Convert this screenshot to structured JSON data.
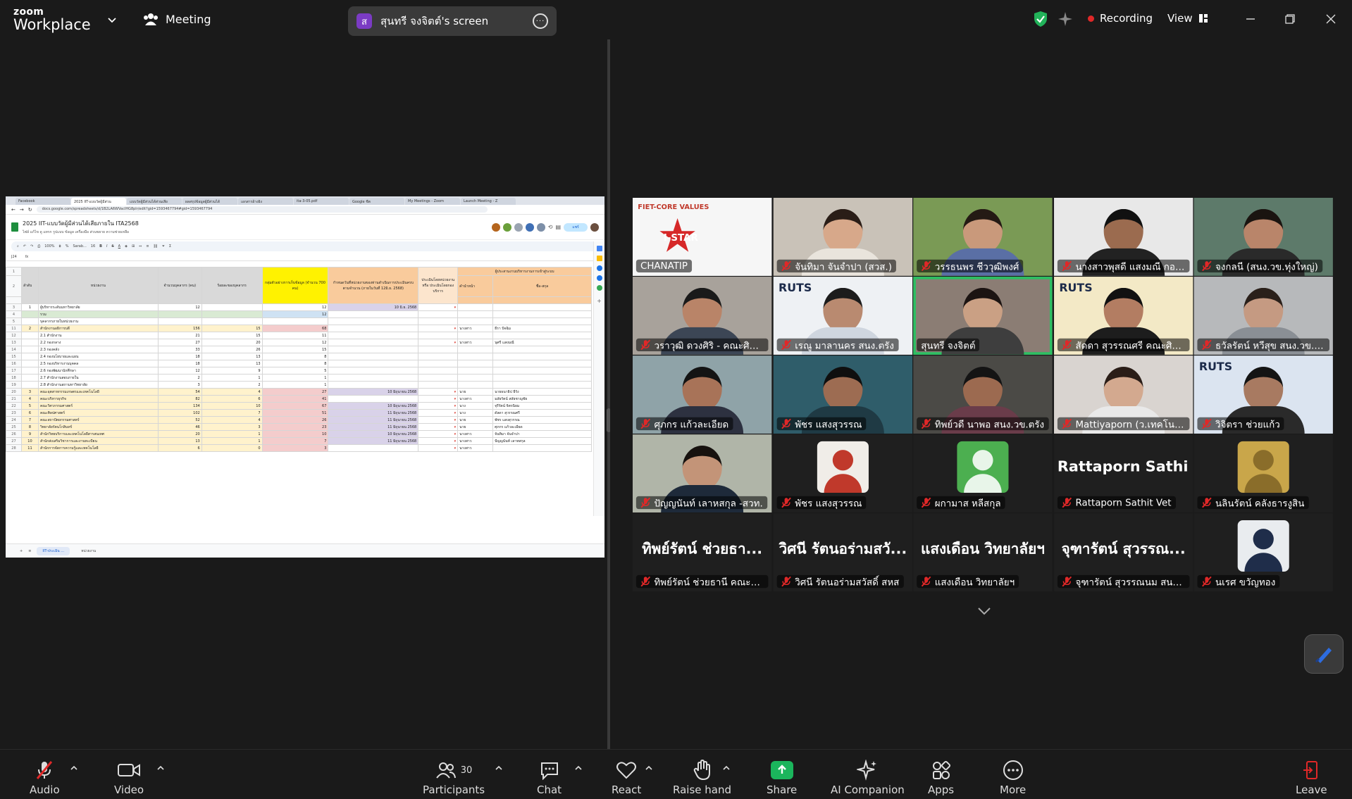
{
  "app": {
    "logo_line1": "zoom",
    "logo_line2": "Workplace",
    "meeting_label": "Meeting",
    "share_avatar_letter": "ส",
    "share_title": "สุนทรี จงจิตต์'s screen",
    "recording_label": "Recording",
    "view_label": "View",
    "accent_green": "#2dbf62",
    "recording_red": "#e02828"
  },
  "shared_screen": {
    "browser_tabs": [
      "Facebook",
      "2025 IIT-แบบวัดผู้มีส่วน",
      "แบบวัดผู้มีส่วนได้ส่วนเสีย",
      "ผลสรุปข้อมูลผู้มีส่วนได้",
      "เอกสารอ้างอิง",
      "ita-3-05.pdf",
      "Google ชีต",
      "My Meetings - Zoom",
      "Launch Meeting - Z"
    ],
    "url": "docs.google.com/spreadsheets/d/1B2LA6WVacIHG8plr/edit?gid=1593467794#gid=1593467794",
    "doc_title": "2025 IIT-แบบวัดผู้มีส่วนได้เสียภายใน ITA2568",
    "doc_menu": "ไฟล์  แก้ไข  ดู  แทรก  รูปแบบ  ข้อมูล  เครื่องมือ  ส่วนขยาย  ความช่วยเหลือ",
    "share_btn": "แชร์",
    "toolbar_zoom": "100%",
    "toolbar_font": "Sarab...",
    "toolbar_size": "16",
    "cell_ref": "J24",
    "headers": {
      "col_no": "ลำดับ",
      "col_unit": "หน่วยงาน",
      "col_staff": "จำนวนบุคลากร (คน)",
      "col_pct": "ร้อยละของบุคลากร",
      "col_target": "กลุ่มตัวอย่างการเก็บข้อมูล (จำนวน 700 คน)",
      "col_deadline": "กำหนดวันที่หน่วยงานของท่านดำเนินการประเมินครบตามจำนวน (ภายในวันที่ 12มิ.ย. 2568)",
      "col_eval": "ประเมินโดยหน่วยงาน หรือ ประเมินโดยกองบริการ",
      "col_contact": "ผู้ประสานงานบริหารงานการเข้าสู่ระบบ",
      "col_prefix": "คำนำหน้า",
      "col_name": "ชื่อ-สกุล"
    },
    "rows": [
      {
        "rn": "3",
        "no": "1",
        "unit": "ผู้บริหารระดับมหาวิทยาลัย",
        "staff": "12",
        "pct": "",
        "target": "12",
        "date": "10 มิ.ย. 2568",
        "prefix": "",
        "name": "",
        "tone": "plain"
      },
      {
        "rn": "4",
        "no": "",
        "unit": "รวม",
        "staff": "",
        "pct": "",
        "target": "12",
        "date": "",
        "prefix": "",
        "name": "",
        "tone": "green"
      },
      {
        "rn": "5",
        "no": "",
        "unit": "บุคลากรภายในหน่วยงาน",
        "staff": "",
        "pct": "",
        "target": "",
        "date": "",
        "prefix": "",
        "name": "",
        "tone": "plain"
      },
      {
        "rn": "11",
        "no": "2",
        "unit": "สำนักงานอธิการบดี",
        "staff": "156",
        "pct": "15",
        "target": "68",
        "date": "",
        "prefix": "นางสาว",
        "name": "ธีรา ปัจฉิม",
        "tone": "yellow"
      },
      {
        "rn": "12",
        "no": "",
        "unit": "2.1 สำนักงาน",
        "staff": "21",
        "pct": "15",
        "target": "11",
        "date": "",
        "prefix": "",
        "name": "",
        "tone": "plain"
      },
      {
        "rn": "13",
        "no": "",
        "unit": "2.2 กองกลาง",
        "staff": "27",
        "pct": "20",
        "target": "12",
        "date": "",
        "prefix": "นางสาว",
        "name": "นุศรี แสงมณี",
        "tone": "plain"
      },
      {
        "rn": "14",
        "no": "",
        "unit": "2.3 กองคลัง",
        "staff": "33",
        "pct": "26",
        "target": "15",
        "date": "",
        "prefix": "",
        "name": "",
        "tone": "plain"
      },
      {
        "rn": "15",
        "no": "",
        "unit": "2.4 กองนโยบายและแผน",
        "staff": "18",
        "pct": "13",
        "target": "8",
        "date": "",
        "prefix": "",
        "name": "",
        "tone": "plain"
      },
      {
        "rn": "16",
        "no": "",
        "unit": "2.5 กองบริหารงานบุคคล",
        "staff": "18",
        "pct": "13",
        "target": "8",
        "date": "",
        "prefix": "",
        "name": "",
        "tone": "plain"
      },
      {
        "rn": "17",
        "no": "",
        "unit": "2.6 กองพัฒนานักศึกษา",
        "staff": "12",
        "pct": "9",
        "target": "5",
        "date": "",
        "prefix": "",
        "name": "",
        "tone": "plain"
      },
      {
        "rn": "18",
        "no": "",
        "unit": "2.7 สำนักงานสอบภายใน",
        "staff": "2",
        "pct": "1",
        "target": "1",
        "date": "",
        "prefix": "",
        "name": "",
        "tone": "plain"
      },
      {
        "rn": "19",
        "no": "",
        "unit": "2.8 สำนักงานสภามหาวิทยาลัย",
        "staff": "3",
        "pct": "2",
        "target": "1",
        "date": "",
        "prefix": "",
        "name": "",
        "tone": "plain"
      },
      {
        "rn": "20",
        "no": "3",
        "unit": "คณะอุตสาหกรรมเกษตรและเทคโนโลยี",
        "staff": "54",
        "pct": "4",
        "target": "27",
        "date": "10 มิถุนายน 2568",
        "prefix": "นาย",
        "name": "นายธนาธิป ธีรัง",
        "tone": "yellow"
      },
      {
        "rn": "21",
        "no": "4",
        "unit": "คณะบริหารธุรกิจ",
        "staff": "82",
        "pct": "6",
        "target": "41",
        "date": "",
        "prefix": "นางสาว",
        "name": "มลัยรัตน์ สลัยชาญชัย",
        "tone": "yellow"
      },
      {
        "rn": "22",
        "no": "5",
        "unit": "คณะวิศวกรรมศาสตร์",
        "staff": "134",
        "pct": "10",
        "target": "67",
        "date": "10 มิถุนายน 2568",
        "prefix": "นาง",
        "name": "จุรีรัตน์ จิตรนิยม",
        "tone": "yellow"
      },
      {
        "rn": "23",
        "no": "6",
        "unit": "คณะศิลปศาสตร์",
        "staff": "102",
        "pct": "7",
        "target": "51",
        "date": "11 มิถุนายน 2568",
        "prefix": "นาง",
        "name": "ดัลดา สุวรรณศรี",
        "tone": "yellow"
      },
      {
        "rn": "24",
        "no": "7",
        "unit": "คณะสถาปัตยกรรมศาสตร์",
        "staff": "52",
        "pct": "4",
        "target": "26",
        "date": "11 มิถุนายน 2568",
        "prefix": "นาย",
        "name": "พัชร แสงสุวรรณ",
        "tone": "yellow"
      },
      {
        "rn": "25",
        "no": "8",
        "unit": "วิทยาลัยรัตนโกสินทร์",
        "staff": "46",
        "pct": "3",
        "target": "23",
        "date": "11 มิถุนายน 2568",
        "prefix": "นาย",
        "name": "ศุภกร แก้วละเอียด",
        "tone": "yellow"
      },
      {
        "rn": "26",
        "no": "9",
        "unit": "สำนักวิทยบริการและเทคโนโลยีสารสนเทศ",
        "staff": "20",
        "pct": "1",
        "target": "10",
        "date": "10 มิถุนายน 2568",
        "prefix": "นางสาว",
        "name": "จันทิมา จันจำปา",
        "tone": "yellow"
      },
      {
        "rn": "27",
        "no": "10",
        "unit": "สำนักส่งเสริมวิชาการและงานทะเบียน",
        "staff": "13",
        "pct": "1",
        "target": "7",
        "date": "11 มิถุนายน 2568",
        "prefix": "นางสาว",
        "name": "ปัญญนันท์ เลาหสกุล",
        "tone": "yellow"
      },
      {
        "rn": "28",
        "no": "11",
        "unit": "สำนักการจัดการความรู้และเทคโนโลยี",
        "staff": "6",
        "pct": "0",
        "target": "3",
        "date": "",
        "prefix": "นางสาว",
        "name": "",
        "tone": "yellow"
      }
    ],
    "sheet_tabs": [
      "IIT-ประเมิน ...",
      "หน่วยงาน"
    ]
  },
  "gallery": {
    "tiles": [
      {
        "name": "CHANATIP",
        "kind": "slide",
        "muted": false,
        "bg": "#f2f2f2",
        "slide_title": "FIET-CORE VALUES",
        "slide_big": "I-STAR"
      },
      {
        "name": "จันทิมา จันจำปา (สวส.)",
        "kind": "person",
        "muted": true,
        "bg": "#c9c2b8",
        "skin": "#d7a88a",
        "shirt": "#e9e4dc",
        "hair": "#2a1d17"
      },
      {
        "name": "วรรธนพร ชีววุฒิพงศ์",
        "kind": "person",
        "muted": true,
        "bg": "#7a9a55",
        "skin": "#c9997b",
        "shirt": "#5a6fa5",
        "hair": "#241a14"
      },
      {
        "name": "นางสาวพุสดี แสงมณี กอง...",
        "kind": "person",
        "muted": true,
        "bg": "#e8e8e8",
        "skin": "#9b6b4f",
        "shirt": "#222222",
        "hair": "#111111"
      },
      {
        "name": "จงกลนี (สนง.วข.ทุ่งใหญ่)",
        "kind": "person",
        "muted": true,
        "bg": "#5d7a6a",
        "skin": "#b9856a",
        "shirt": "#2a2a2a",
        "hair": "#1a1410"
      },
      {
        "name": "วราวุฒิ ดวงศิริ - คณะศิลปศาส...",
        "kind": "person",
        "muted": true,
        "bg": "#a8a29b",
        "skin": "#b98468",
        "shirt": "#3c4655",
        "hair": "#1a1a1a"
      },
      {
        "name": "เรณู มาลานคร สนง.ตรัง",
        "kind": "person",
        "muted": true,
        "bg": "#eef1f4",
        "skin": "#b98a70",
        "shirt": "#cfd6df",
        "hair": "#1c1c1c",
        "badge": "RUTS"
      },
      {
        "name": "สุนทรี จงจิตต์",
        "kind": "person",
        "muted": false,
        "bg": "#8b7d74",
        "skin": "#caa084",
        "shirt": "#3e3e3e",
        "hair": "#1c1412",
        "active": true
      },
      {
        "name": "สัดดา สุวรรณศรี คณะศิลป...",
        "kind": "person",
        "muted": true,
        "bg": "#f3e9c6",
        "skin": "#b37d62",
        "shirt": "#1d1d1d",
        "hair": "#111111",
        "badge": "RUTS"
      },
      {
        "name": "ธวัลรัตน์ หวีสุข สนง.วข.น...",
        "kind": "person",
        "muted": true,
        "bg": "#b7b9bb",
        "skin": "#c59a82",
        "shirt": "#8a8f95",
        "hair": "#2a201a"
      },
      {
        "name": "ศุภกร แก้วละเอียด",
        "kind": "person",
        "muted": true,
        "bg": "#8fa3a8",
        "skin": "#a87358",
        "shirt": "#2d3140",
        "hair": "#141414"
      },
      {
        "name": "พัชร แสงสุวรรณ",
        "kind": "person",
        "muted": true,
        "bg": "#2f5d6a",
        "skin": "#9d6c52",
        "shirt": "#1f3a44",
        "hair": "#0f0f0f"
      },
      {
        "name": "ทิพย์วดี นาพอ สนง.วข.ตรัง",
        "kind": "person",
        "muted": true,
        "bg": "#4b4a46",
        "skin": "#9c6a50",
        "shirt": "#6a3c4a",
        "hair": "#141414"
      },
      {
        "name": "Mattiyaporn (ว.เทคโนโล...",
        "kind": "person",
        "muted": true,
        "bg": "#d9d4d0",
        "skin": "#d3a98f",
        "shirt": "#e9e9e9",
        "hair": "#2a1d17"
      },
      {
        "name": "วิจิตรา ช่วยแก้ว",
        "kind": "person",
        "muted": true,
        "bg": "#dbe4f0",
        "skin": "#a87a61",
        "shirt": "#2a2a2a",
        "hair": "#141414",
        "badge": "RUTS"
      },
      {
        "name": "ปัญญนันท์ เลาหสกุล -สวท.",
        "kind": "person",
        "muted": true,
        "bg": "#b0b5a8",
        "skin": "#c39478",
        "shirt": "#1e2a3a",
        "hair": "#17120f"
      },
      {
        "name": "พัชร แสงสุวรรณ",
        "kind": "avatar",
        "muted": true,
        "bg": "#1f1f1f",
        "avatar_color": "#f0ede8",
        "avatar_accent": "#c0392b"
      },
      {
        "name": "ผกามาส หลีสกุล",
        "kind": "avatar",
        "muted": true,
        "bg": "#1f1f1f",
        "avatar_color": "#4caf50",
        "avatar_accent": "#e8f5e9"
      },
      {
        "name": "Rattaporn Sathit Vet",
        "kind": "name-only",
        "muted": true,
        "bg": "#1f1f1f",
        "big": "Rattaporn  Sathi..."
      },
      {
        "name": "นลินรัตน์ คลังธารงูสิน",
        "kind": "avatar",
        "muted": true,
        "bg": "#1f1f1f",
        "avatar_color": "#c9a64a",
        "avatar_accent": "#8a6d2a"
      },
      {
        "name": "ทิพย์รัตน์ ช่วยธานี คณะวิ...",
        "kind": "name-only",
        "muted": true,
        "bg": "#1f1f1f",
        "big": "ทิพย์รัตน์  ช่วยธา..."
      },
      {
        "name": "วิศนี รัตนอร่ามสวัสดิ์ สหส",
        "kind": "name-only",
        "muted": true,
        "bg": "#1f1f1f",
        "big": "วิศนี  รัตนอร่ามสวั..."
      },
      {
        "name": "แสงเดือน วิทยาลัยฯ",
        "kind": "name-only",
        "muted": true,
        "bg": "#1f1f1f",
        "big": "แสงเดือน  วิทยาลัยฯ"
      },
      {
        "name": "จุฑารัตน์ สุวรรณนม สนง.ส...",
        "kind": "name-only",
        "muted": true,
        "bg": "#1f1f1f",
        "big": "จุฑารัตน์  สุวรรณ..."
      },
      {
        "name": "นเรศ ขวัญทอง",
        "kind": "avatar",
        "muted": true,
        "bg": "#1f1f1f",
        "avatar_color": "#e9ecef",
        "avatar_accent": "#1f2d4a"
      }
    ]
  },
  "toolbar": {
    "audio": "Audio",
    "video": "Video",
    "participants": "Participants",
    "participants_count": "30",
    "chat": "Chat",
    "react": "React",
    "raise_hand": "Raise hand",
    "share": "Share",
    "ai_companion": "AI Companion",
    "apps": "Apps",
    "more": "More",
    "leave": "Leave"
  }
}
